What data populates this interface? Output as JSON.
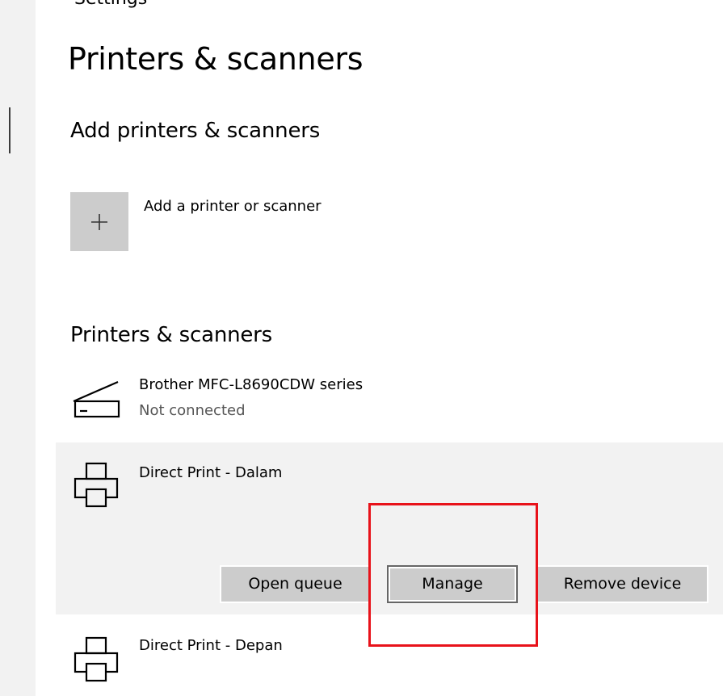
{
  "window": {
    "title_fragment": "Settings"
  },
  "page": {
    "title": "Printers & scanners"
  },
  "add_section": {
    "heading": "Add printers & scanners",
    "add_button_label": "Add a printer or scanner",
    "add_icon": "plus-icon"
  },
  "devices_section": {
    "heading": "Printers & scanners",
    "devices": [
      {
        "name": "Brother MFC-L8690CDW series",
        "status": "Not connected",
        "icon": "scanner-icon"
      },
      {
        "name": "Direct Print - Dalam",
        "status": "",
        "icon": "printer-icon",
        "selected": true,
        "actions": [
          {
            "label": "Open queue"
          },
          {
            "label": "Manage",
            "focused": true
          },
          {
            "label": "Remove device"
          }
        ]
      },
      {
        "name": "Direct Print - Depan",
        "status": "",
        "icon": "printer-icon"
      }
    ]
  },
  "annotation": {
    "highlight_color": "#e8121a",
    "highlight_target": "Manage"
  },
  "colors": {
    "tile_gray": "#cccccc",
    "selected_row_bg": "#f2f2f2",
    "status_text": "#555555"
  }
}
